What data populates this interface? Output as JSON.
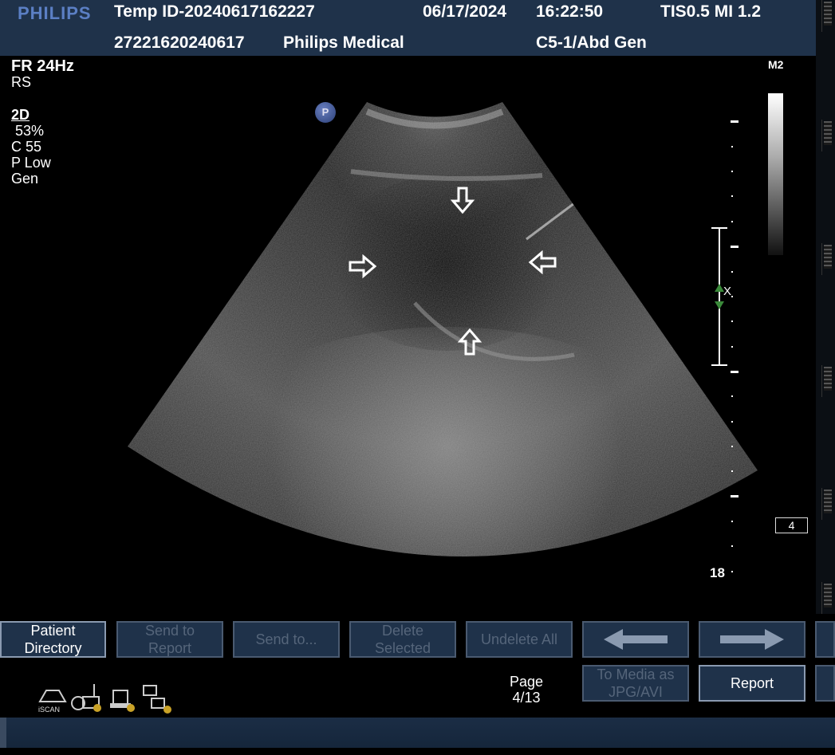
{
  "header": {
    "logo": "PHILIPS",
    "temp_id": "Temp ID-20240617162227",
    "date": "06/17/2024",
    "time": "16:22:50",
    "tis_mi": "TIS0.5  MI 1.2",
    "patient_id": "27221620240617",
    "institution": "Philips Medical",
    "probe_preset": "C5-1/Abd Gen"
  },
  "imaging_params": {
    "frame_rate": "FR 24Hz",
    "res": "RS",
    "mode": "2D",
    "gain": " 53%",
    "compression": "C 55",
    "power": "P Low",
    "preset": "Gen"
  },
  "overlay": {
    "p_badge": "P",
    "map_label": "M2",
    "depth_label": "18",
    "focus_label": "X",
    "page_box": "4"
  },
  "buttons": {
    "patient_directory": "Patient\nDirectory",
    "send_to_report": "Send to\nReport",
    "send_to": "Send to...",
    "delete_selected": "Delete\nSelected",
    "undelete_all": "Undelete All",
    "to_media": "To Media as\nJPG/AVI",
    "report": "Report"
  },
  "pagination": {
    "label": "Page",
    "value": "4/13"
  },
  "status_icons": [
    "iscan-icon",
    "tape-icon",
    "printer-icon",
    "network-icon"
  ],
  "iscan_label": "iSCAN"
}
